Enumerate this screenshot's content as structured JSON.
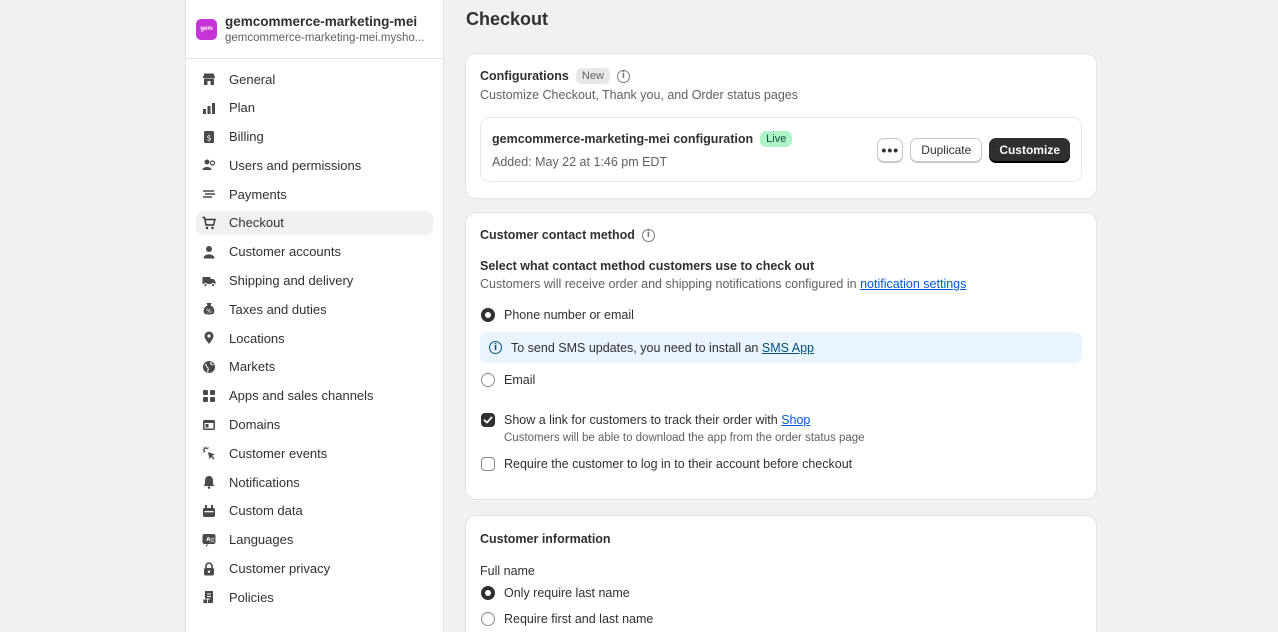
{
  "store": {
    "logo_text": "gem",
    "name": "gemcommerce-marketing-mei",
    "domain": "gemcommerce-marketing-mei.mysho..."
  },
  "sidebar": {
    "items": [
      {
        "label": "General",
        "icon": "store-icon"
      },
      {
        "label": "Plan",
        "icon": "plan-icon"
      },
      {
        "label": "Billing",
        "icon": "billing-icon"
      },
      {
        "label": "Users and permissions",
        "icon": "users-icon"
      },
      {
        "label": "Payments",
        "icon": "payments-icon"
      },
      {
        "label": "Checkout",
        "icon": "cart-icon",
        "active": true
      },
      {
        "label": "Customer accounts",
        "icon": "person-icon"
      },
      {
        "label": "Shipping and delivery",
        "icon": "truck-icon"
      },
      {
        "label": "Taxes and duties",
        "icon": "taxes-icon"
      },
      {
        "label": "Locations",
        "icon": "location-icon"
      },
      {
        "label": "Markets",
        "icon": "globe-icon"
      },
      {
        "label": "Apps and sales channels",
        "icon": "apps-icon"
      },
      {
        "label": "Domains",
        "icon": "domains-icon"
      },
      {
        "label": "Customer events",
        "icon": "cursor-icon"
      },
      {
        "label": "Notifications",
        "icon": "bell-icon"
      },
      {
        "label": "Custom data",
        "icon": "custom-data-icon"
      },
      {
        "label": "Languages",
        "icon": "language-icon"
      },
      {
        "label": "Customer privacy",
        "icon": "lock-icon"
      },
      {
        "label": "Policies",
        "icon": "policies-icon"
      }
    ]
  },
  "page": {
    "title": "Checkout"
  },
  "configurations": {
    "title": "Configurations",
    "badge": "New",
    "description": "Customize Checkout, Thank you, and Order status pages",
    "config_name": "gemcommerce-marketing-mei configuration",
    "status": "Live",
    "added": "Added: May 22 at 1:46 pm EDT",
    "more_label": "•••",
    "duplicate_label": "Duplicate",
    "customize_label": "Customize"
  },
  "contact": {
    "title": "Customer contact method",
    "question": "Select what contact method customers use to check out",
    "desc_prefix": "Customers will receive order and shipping notifications configured in ",
    "desc_link": "notification settings",
    "option_phone_email": "Phone number or email",
    "banner_prefix": "To send SMS updates, you need to install an ",
    "banner_link": "SMS App",
    "option_email": "Email",
    "track_prefix": "Show a link for customers to track their order with ",
    "track_link": "Shop",
    "track_help": "Customers will be able to download the app from the order status page",
    "require_login": "Require the customer to log in to their account before checkout"
  },
  "customer_info": {
    "title": "Customer information",
    "full_name_label": "Full name",
    "option_last_only": "Only require last name",
    "option_first_last": "Require first and last name"
  },
  "colors": {
    "primary_button": "#303030",
    "live_badge": "#aff3c8",
    "info_banner": "#eaf4ff",
    "link": "#005bd3",
    "store_logo": "#c633d6"
  }
}
